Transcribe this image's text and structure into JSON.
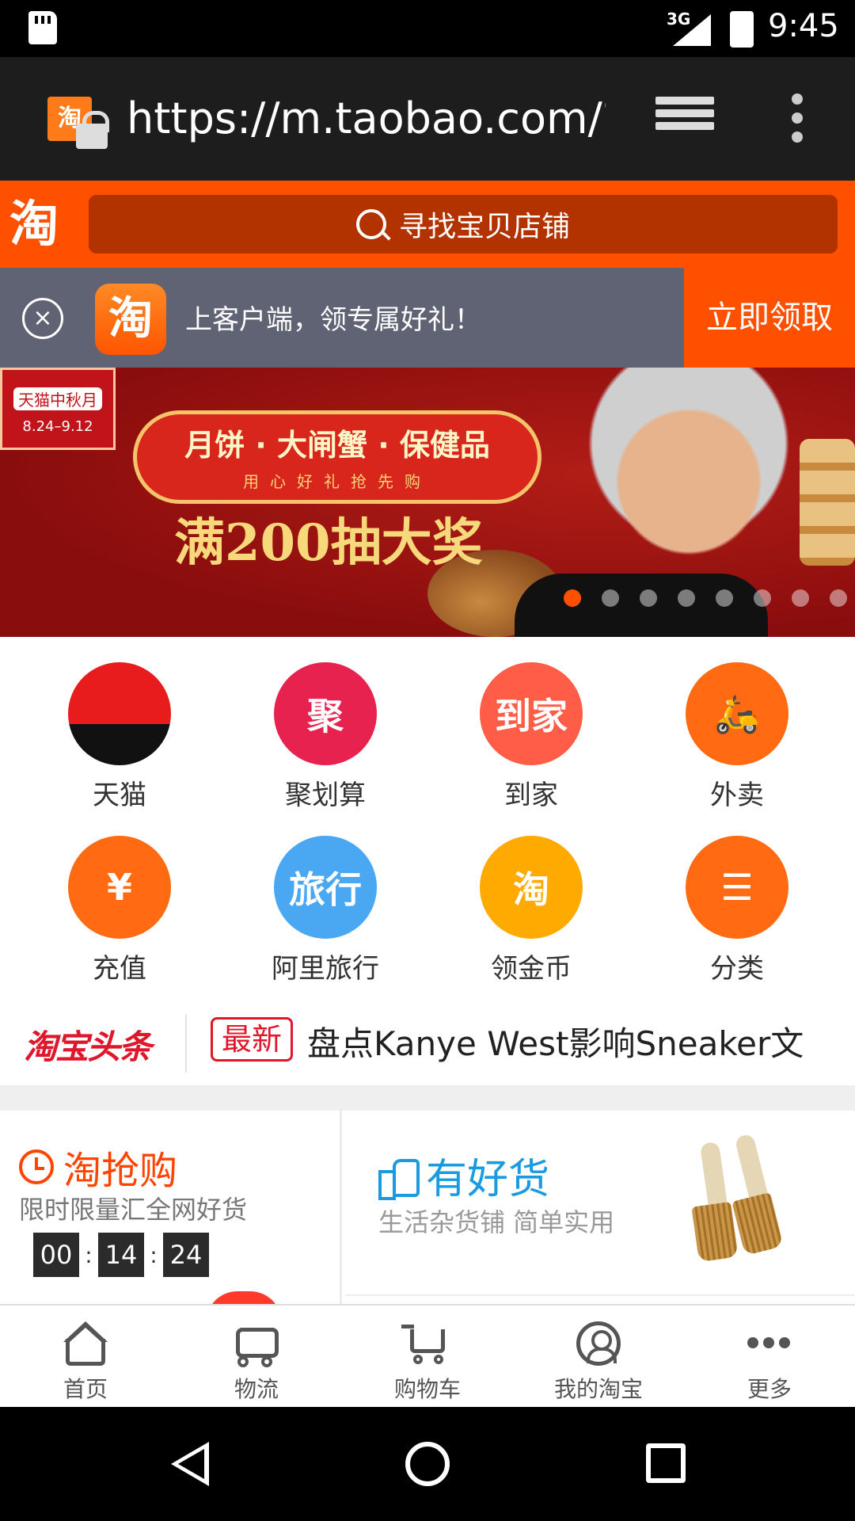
{
  "status_bar": {
    "network": "3G",
    "time": "9:45"
  },
  "browser": {
    "url": "https://m.taobao.com/?sp"
  },
  "header": {
    "logo_text": "淘",
    "search_placeholder": "寻找宝贝店铺"
  },
  "promo": {
    "app_icon_text": "淘",
    "message": "上客户端，领专属好礼！",
    "action_label": "立即领取"
  },
  "banner": {
    "tag_title": "天猫中秋月",
    "tag_date": "8.24–9.12",
    "plaque_title": "月饼 · 大闸蟹 · 保健品",
    "plaque_subtitle": "用心好礼抢先购",
    "headline": "满200抽大奖",
    "slide_count": 8,
    "active_slide": 1
  },
  "quick_links": [
    {
      "label": "天猫",
      "icon": "tmall-cat-icon",
      "icon_text": "",
      "color": "#e81c1c"
    },
    {
      "label": "聚划算",
      "icon": "juhuasuan-icon",
      "icon_text": "聚",
      "color": "#e8224e"
    },
    {
      "label": "到家",
      "icon": "daojia-icon",
      "icon_text": "到家",
      "color": "#ff5d48"
    },
    {
      "label": "外卖",
      "icon": "scooter-icon",
      "icon_text": "🛵",
      "color": "#ff6a12"
    },
    {
      "label": "充值",
      "icon": "phone-recharge-icon",
      "icon_text": "¥",
      "color": "#ff6a12"
    },
    {
      "label": "阿里旅行",
      "icon": "travel-icon",
      "icon_text": "旅行",
      "color": "#4aa8f3"
    },
    {
      "label": "领金币",
      "icon": "gold-coin-icon",
      "icon_text": "淘",
      "color": "#ffaa00"
    },
    {
      "label": "分类",
      "icon": "category-list-icon",
      "icon_text": "☰",
      "color": "#ff6a12"
    }
  ],
  "news": {
    "logo": "淘宝头条",
    "tag": "最新",
    "headline": "盘点Kanye West影响Sneaker文"
  },
  "flash_sale": {
    "title": "淘抢购",
    "subtitle": "限时限量汇全网好货",
    "timer": {
      "hours": "00",
      "minutes": "14",
      "seconds": "24"
    }
  },
  "good_goods": {
    "title": "有好货",
    "subtitle": "生活杂货铺 简单实用"
  },
  "tab_bar": [
    {
      "label": "首页",
      "icon": "home-icon"
    },
    {
      "label": "物流",
      "icon": "truck-icon"
    },
    {
      "label": "购物车",
      "icon": "cart-icon"
    },
    {
      "label": "我的淘宝",
      "icon": "user-icon"
    },
    {
      "label": "更多",
      "icon": "more-icon"
    }
  ],
  "colors": {
    "brand": "#ff5000",
    "search_bg": "#b23200",
    "promo_bg": "#5f6373",
    "news_red": "#e0162b",
    "good_goods_blue": "#1a9be0"
  }
}
